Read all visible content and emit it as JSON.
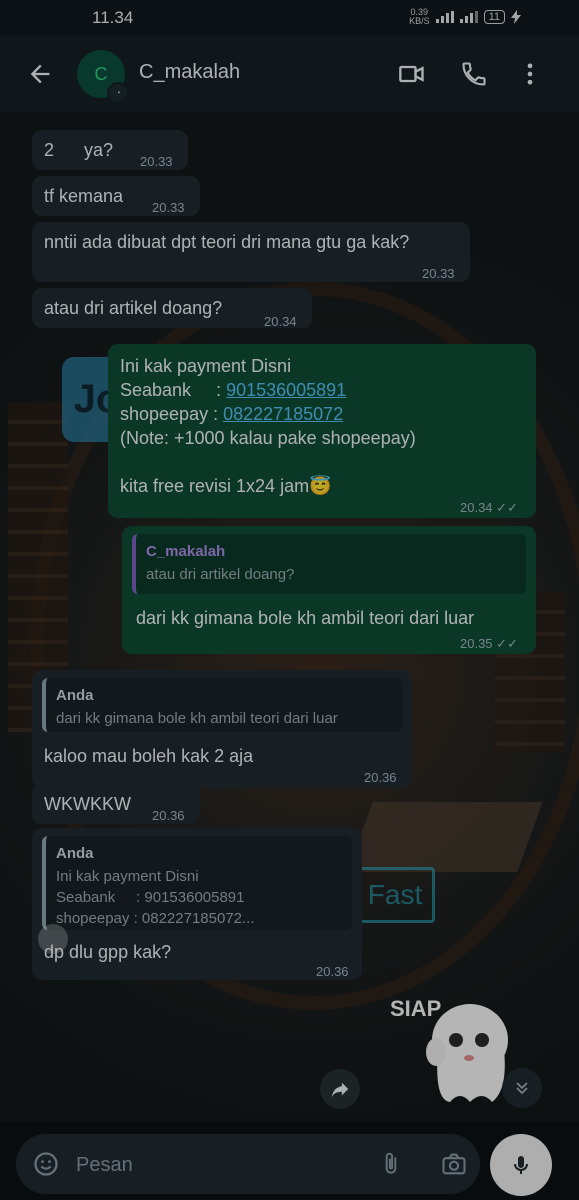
{
  "status_bar": {
    "time": "11.34",
    "net_speed": "0.39",
    "net_unit": "KB/S",
    "battery": "11"
  },
  "header": {
    "avatar_letter": "C",
    "contact_name": "C_makalah"
  },
  "messages": [
    {
      "text": "2      ya?",
      "time": "20.33"
    },
    {
      "text": "tf kemana",
      "time": "20.33"
    },
    {
      "text": "nntii ada dibuat dpt teori dri mana gtu ga kak?",
      "time": "20.33"
    },
    {
      "text": "atau dri artikel doang?",
      "time": "20.34"
    },
    {
      "line1": "Ini kak payment Disni",
      "seabank_label": "Seabank     : ",
      "seabank_number": "901536005891",
      "shopeepay_label": "shopeepay : ",
      "shopeepay_number": "082227185072",
      "note": "(Note: +1000 kalau pake shopeepay)",
      "revisi": "kita free revisi  1x24 jam😇",
      "time": "20.34"
    },
    {
      "quote_author": "C_makalah",
      "quote_text": "atau dri artikel doang?",
      "text": "dari kk gimana bole kh ambil teori dari luar",
      "time": "20.35"
    },
    {
      "quote_author": "Anda",
      "quote_text": "dari kk gimana bole kh ambil teori dari luar",
      "text": "kaloo mau boleh kak 2 aja",
      "time": "20.36"
    },
    {
      "text": "WKWKKW",
      "time": "20.36"
    },
    {
      "quote_author": "Anda",
      "quote_text": "Ini kak payment Disni\nSeabank     : 901536005891\nshopeepay : 082227185072...",
      "text": "dp dlu gpp kak?",
      "time": "20.36"
    }
  ],
  "wallpaper": {
    "logo_text": "Jo",
    "fast_text": "Fast"
  },
  "sticker_text": "SIAP",
  "input": {
    "placeholder": "Pesan"
  },
  "colors": {
    "outgoing": "#0f4a35",
    "incoming": "#1f2a30",
    "accent": "#30c97a"
  }
}
